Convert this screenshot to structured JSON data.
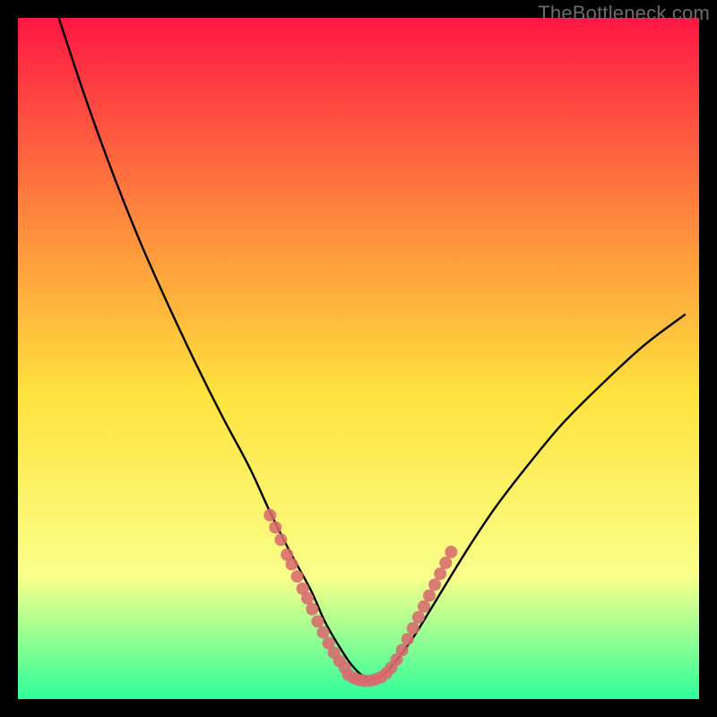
{
  "watermark": "TheBottleneck.com",
  "chart_data": {
    "type": "line",
    "title": "",
    "xlabel": "",
    "ylabel": "",
    "xlim": [
      0,
      100
    ],
    "ylim": [
      0,
      100
    ],
    "background_gradient": {
      "top": "#ff1744",
      "mid_upper": "#ff8a3d",
      "mid": "#ffe23d",
      "mid_lower": "#faff8a",
      "bottom": "#2eff9b"
    },
    "series": [
      {
        "name": "bottleneck-curve",
        "stroke": "#000000",
        "x": [
          6,
          10,
          14,
          18,
          22,
          26,
          30,
          34,
          37,
          40,
          43,
          45,
          47,
          49,
          51,
          53,
          55,
          58,
          62,
          66,
          70,
          75,
          80,
          86,
          92,
          98
        ],
        "y": [
          100,
          88,
          77,
          67,
          58,
          49.5,
          41.5,
          34,
          27.5,
          21.5,
          16,
          11.5,
          8,
          5,
          3.2,
          3.2,
          5,
          9,
          15.5,
          22,
          28,
          34.5,
          40.5,
          46.5,
          52,
          56.5
        ]
      }
    ],
    "scatter": [
      {
        "name": "cluster-lower-left-arm",
        "fill": "#d86a6e",
        "points": [
          [
            37,
            27
          ],
          [
            37.8,
            25.2
          ],
          [
            38.6,
            23.4
          ],
          [
            39.5,
            21.2
          ],
          [
            40.2,
            19.8
          ],
          [
            41,
            18
          ],
          [
            41.8,
            16.2
          ],
          [
            42.5,
            14.8
          ],
          [
            43.2,
            13.2
          ],
          [
            44,
            11.4
          ],
          [
            44.8,
            9.8
          ],
          [
            45.6,
            8.2
          ],
          [
            46.4,
            6.8
          ],
          [
            47.2,
            5.6
          ],
          [
            48,
            4.6
          ]
        ]
      },
      {
        "name": "cluster-valley-floor",
        "fill": "#d86a6e",
        "points": [
          [
            48.5,
            3.6
          ],
          [
            49.3,
            3.1
          ],
          [
            50.1,
            2.8
          ],
          [
            50.9,
            2.7
          ],
          [
            51.7,
            2.7
          ],
          [
            52.5,
            2.9
          ],
          [
            53.3,
            3.2
          ],
          [
            54.1,
            3.8
          ]
        ]
      },
      {
        "name": "cluster-lower-right-arm",
        "fill": "#d86a6e",
        "points": [
          [
            54.8,
            4.6
          ],
          [
            55.6,
            5.8
          ],
          [
            56.4,
            7.2
          ],
          [
            57.2,
            8.8
          ],
          [
            58,
            10.4
          ],
          [
            58.8,
            12
          ],
          [
            59.6,
            13.6
          ],
          [
            60.4,
            15.2
          ],
          [
            61.2,
            16.8
          ],
          [
            62,
            18.4
          ],
          [
            62.8,
            20
          ],
          [
            63.6,
            21.6
          ]
        ]
      }
    ]
  }
}
